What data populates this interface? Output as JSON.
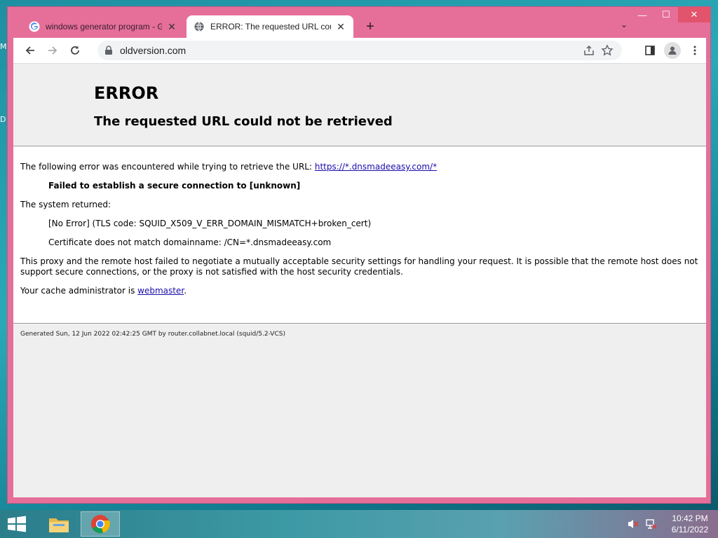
{
  "desktop": {
    "edge_labels": [
      "M",
      "D"
    ]
  },
  "browser": {
    "tabs": [
      {
        "title": "windows generator program - Go",
        "favicon": "google-icon",
        "active": false
      },
      {
        "title": "ERROR: The requested URL could",
        "favicon": "globe-icon",
        "active": true
      }
    ],
    "new_tab_label": "+",
    "tab_search_label": "⌄",
    "window_controls": {
      "minimize": "—",
      "maximize": "☐",
      "close": "✕"
    },
    "address_bar": {
      "url": "oldversion.com"
    }
  },
  "page": {
    "title": "ERROR",
    "subtitle": "The requested URL could not be retrieved",
    "intro_text": "The following error was encountered while trying to retrieve the URL:",
    "intro_link": "https://*.dnsmadeeasy.com/*",
    "failure": "Failed to establish a secure connection to [unknown]",
    "system_returned_label": "The system returned:",
    "system_error": "[No Error] (TLS code: SQUID_X509_V_ERR_DOMAIN_MISMATCH+broken_cert)",
    "cert_error": "Certificate does not match domainname: /CN=*.dnsmadeeasy.com",
    "explanation": "This proxy and the remote host failed to negotiate a mutually acceptable security settings for handling your request. It is possible that the remote host does not support secure connections, or the proxy is not satisfied with the host security credentials.",
    "admin_prefix": "Your cache administrator is ",
    "admin_link": "webmaster",
    "admin_suffix": ".",
    "footer": "Generated Sun, 12 Jun 2022 02:42:25 GMT by router.collabnet.local (squid/5.2-VCS)"
  },
  "taskbar": {
    "apps": [
      "file-explorer-icon",
      "chrome-icon"
    ],
    "clock_time": "10:42 PM",
    "clock_date": "6/11/2022"
  },
  "colors": {
    "window_frame": "#e66f99",
    "close_button": "#e2536c",
    "link": "#1a0dab"
  }
}
